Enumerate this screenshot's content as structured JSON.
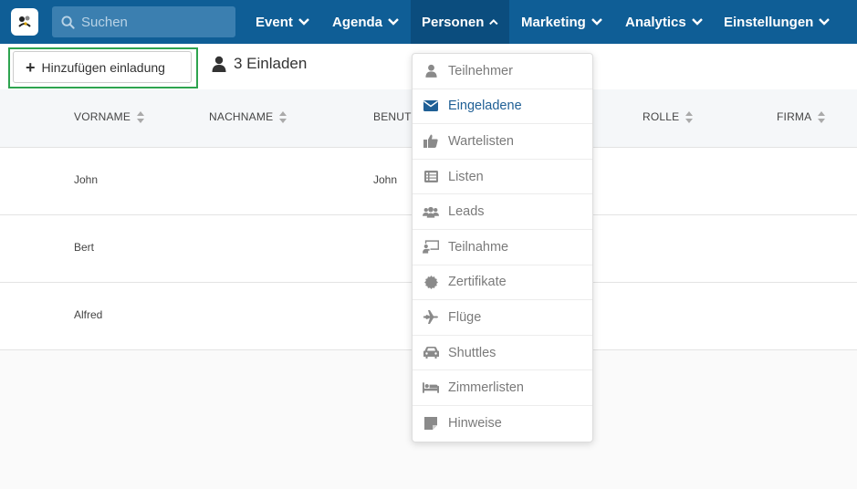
{
  "topnav": {
    "search_placeholder": "Suchen",
    "items": [
      {
        "label": "Event"
      },
      {
        "label": "Agenda"
      },
      {
        "label": "Personen"
      },
      {
        "label": "Marketing"
      },
      {
        "label": "Analytics"
      },
      {
        "label": "Einstellungen"
      }
    ],
    "active_item": "Personen"
  },
  "toolbar": {
    "add_label": "Hinzufügen einladung",
    "invite_count_label": "3 Einladen"
  },
  "table": {
    "columns": [
      "VORNAME",
      "NACHNAME",
      "BENUT",
      "ROLLE",
      "FIRMA"
    ],
    "rows": [
      {
        "vorname": "John",
        "nachname": "",
        "benutzer": "John"
      },
      {
        "vorname": "Bert",
        "nachname": "",
        "benutzer": ""
      },
      {
        "vorname": "Alfred",
        "nachname": "",
        "benutzer": ""
      }
    ]
  },
  "dropdown": {
    "items": [
      {
        "label": "Teilnehmer",
        "icon": "user-icon"
      },
      {
        "label": "Eingeladene",
        "icon": "envelope-icon"
      },
      {
        "label": "Wartelisten",
        "icon": "thumbs-up-icon"
      },
      {
        "label": "Listen",
        "icon": "list-icon"
      },
      {
        "label": "Leads",
        "icon": "users-icon"
      },
      {
        "label": "Teilnahme",
        "icon": "chalkboard-user-icon"
      },
      {
        "label": "Zertifikate",
        "icon": "certificate-icon"
      },
      {
        "label": "Flüge",
        "icon": "plane-icon"
      },
      {
        "label": "Shuttles",
        "icon": "car-icon"
      },
      {
        "label": "Zimmerlisten",
        "icon": "bed-icon"
      },
      {
        "label": "Hinweise",
        "icon": "sticky-note-icon"
      }
    ],
    "active_item": "Eingeladene"
  },
  "colors": {
    "nav_bg": "#0f5e96",
    "nav_active_bg": "#0b4d7e",
    "highlight": "#2ea44f",
    "dropdown_active": "#1f5f95"
  }
}
